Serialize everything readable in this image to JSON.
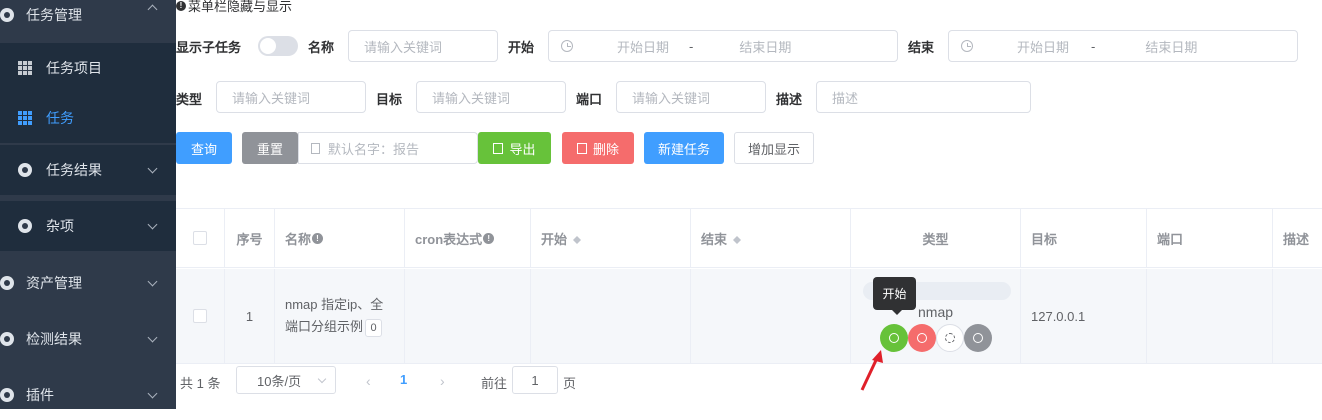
{
  "sidebar": {
    "items": [
      {
        "label": "任务管理",
        "icon": "circle-icon"
      },
      {
        "label": "任务项目",
        "icon": "grid-icon"
      },
      {
        "label": "任务",
        "icon": "grid-icon"
      },
      {
        "label": "任务结果",
        "icon": "circle-icon"
      },
      {
        "label": "杂项",
        "icon": "circle-icon"
      },
      {
        "label": "资产管理",
        "icon": "circle-icon"
      },
      {
        "label": "检测结果",
        "icon": "circle-icon"
      },
      {
        "label": "插件",
        "icon": "circle-icon"
      }
    ],
    "active_color": "#409eff"
  },
  "top_tip": "菜单栏隐藏与显示",
  "filters": {
    "show_children_label": "显示子任务",
    "name_label": "名称",
    "name_placeholder": "请输入关键词",
    "start_label": "开始",
    "start_from": "开始日期",
    "start_sep": "-",
    "start_to": "结束日期",
    "end_label": "结束",
    "end_from": "开始日期",
    "end_sep": "-",
    "end_to": "结束日期",
    "type_label": "类型",
    "type_placeholder": "请输入关键词",
    "target_label": "目标",
    "target_placeholder": "请输入关键词",
    "port_label": "端口",
    "port_placeholder": "请输入关键词",
    "desc_label": "描述",
    "desc_placeholder": "描述"
  },
  "toolbar": {
    "query": "查询",
    "reset": "重置",
    "report_placeholder": "默认名字：报告",
    "export": "导出",
    "delete": "删除",
    "new_task": "新建任务",
    "add_display": "增加显示"
  },
  "table": {
    "headers": {
      "index": "序号",
      "name": "名称",
      "cron": "cron表达式",
      "start": "开始",
      "end": "结束",
      "type": "类型",
      "target": "目标",
      "port": "端口",
      "desc": "描述"
    },
    "rows": [
      {
        "index": "1",
        "name": "nmap 指定ip、全端口分组示例",
        "children": "0",
        "type": "nmap",
        "target": "127.0.0.1"
      }
    ]
  },
  "tooltip": "开始",
  "pagination": {
    "total": "共 1 条",
    "page_size": "10条/页",
    "current": "1",
    "goto_label": "前往",
    "goto_value": "1",
    "page_suffix": "页"
  },
  "colors": {
    "primary": "#409eff",
    "success": "#67c23a",
    "danger": "#f56c6c",
    "info": "#909399",
    "annotation_arrow": "#e0202a"
  }
}
